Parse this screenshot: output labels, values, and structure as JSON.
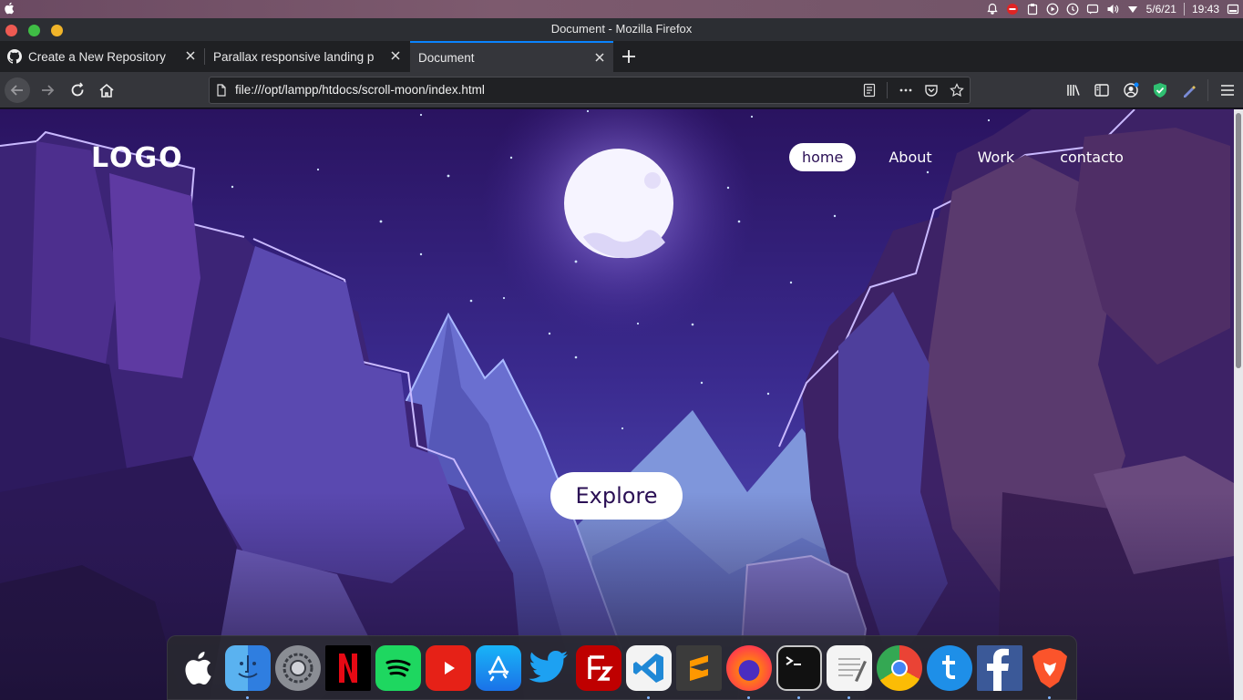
{
  "system_bar": {
    "date": "5/6/21",
    "time": "19:43"
  },
  "window": {
    "title": "Document - Mozilla Firefox"
  },
  "tabs": [
    {
      "label": "Create a New Repository",
      "active": false
    },
    {
      "label": "Parallax responsive landing p",
      "active": false
    },
    {
      "label": "Document",
      "active": true
    }
  ],
  "url_bar": {
    "url": "file:///opt/lampp/htdocs/scroll-moon/index.html"
  },
  "page": {
    "logo": "LOGO",
    "nav": [
      {
        "label": "home",
        "active": true
      },
      {
        "label": "About",
        "active": false
      },
      {
        "label": "Work",
        "active": false
      },
      {
        "label": "contacto",
        "active": false
      }
    ],
    "explore_label": "Explore"
  },
  "dock": {
    "apps": [
      "apple-icon",
      "finder-icon",
      "system-preferences-icon",
      "netflix-icon",
      "spotify-icon",
      "youtube-icon",
      "app-store-icon",
      "twitter-icon",
      "filezilla-icon",
      "vscode-icon",
      "sublime-text-icon",
      "firefox-icon",
      "terminal-icon",
      "text-editor-icon",
      "chrome-icon",
      "mail-icon",
      "facebook-icon",
      "brave-icon"
    ]
  },
  "colors": {
    "accent": "#0a84ff",
    "sky_top": "#2b1055",
    "sky_mid": "#3d2a8c",
    "button_text": "#2b1055"
  }
}
